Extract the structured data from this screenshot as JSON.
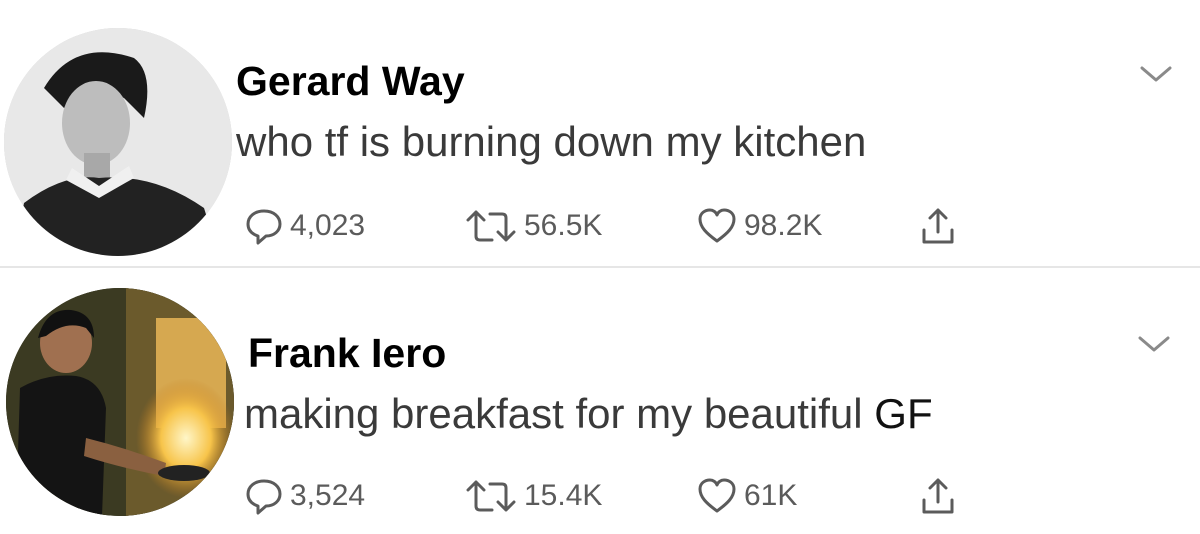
{
  "tweets": [
    {
      "author": "Gerard Way",
      "text": "who tf is burning down my kitchen",
      "text_tail": "",
      "replies": "4,023",
      "retweets": "56.5K",
      "likes": "98.2K",
      "avatar_icon": "user-avatar-grayscale"
    },
    {
      "author": "Frank Iero",
      "text": "making breakfast for my beautiful ",
      "text_tail": "GF",
      "replies": "3,524",
      "retweets": "15.4K",
      "likes": "61K",
      "avatar_icon": "user-avatar-kitchen-fire"
    }
  ],
  "icons": {
    "reply": "reply-icon",
    "retweet": "retweet-icon",
    "like": "heart-icon",
    "share": "share-icon",
    "menu": "chevron-down-icon"
  },
  "colors": {
    "icon_gray": "#5b5b5b",
    "divider": "#e6e6e6",
    "text": "#3a3a3a"
  }
}
